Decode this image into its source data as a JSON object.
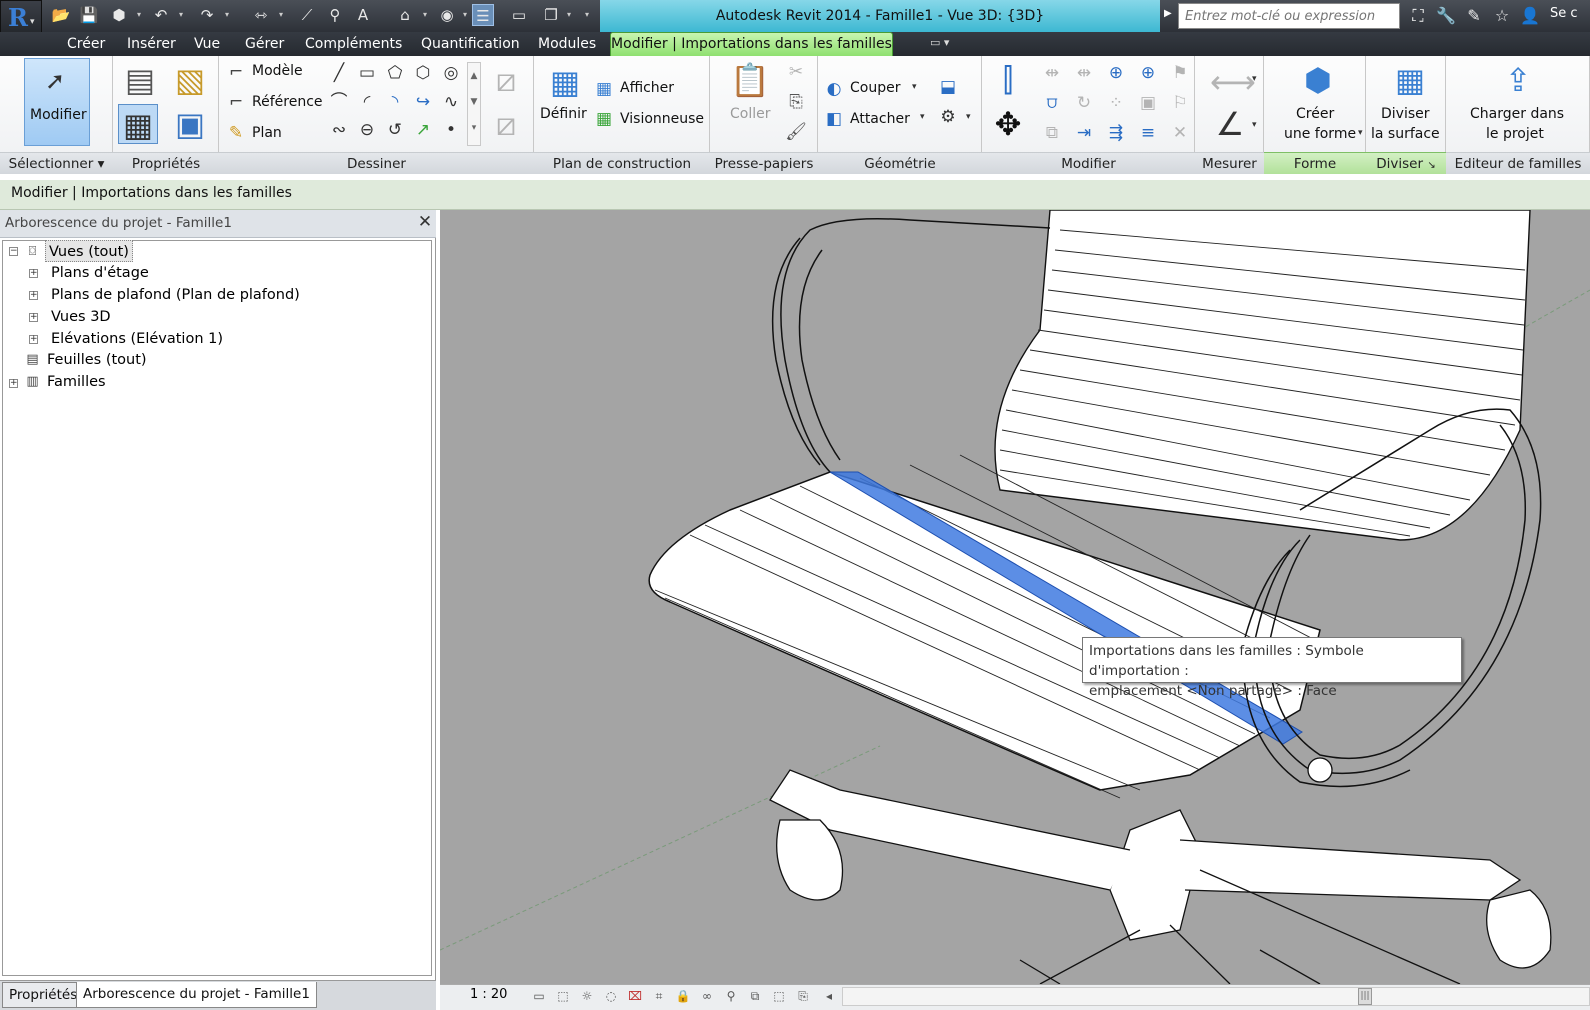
{
  "window": {
    "title": "Autodesk Revit 2014 -     Famille1 - Vue 3D: {3D}",
    "search_placeholder": "Entrez mot-clé ou expression",
    "signin_text": "Se c",
    "title_band_color": "#53c6dc"
  },
  "qat_icons": [
    "open-icon",
    "save-icon",
    "cube-icon",
    "undo-icon",
    "redo-icon",
    "measure-icon",
    "dimension-icon",
    "tag-icon",
    "text-icon",
    "3d-view-icon",
    "section-icon",
    "thin-lines-icon",
    "close-views-icon",
    "switch-windows-icon",
    "customize-icon"
  ],
  "tabs": [
    "Créer",
    "Insérer",
    "Vue",
    "Gérer",
    "Compléments",
    "Quantification",
    "Modules"
  ],
  "active_tab": "Modifier | Importations dans les familles",
  "ribbon": {
    "select": {
      "modify": "Modifier",
      "label": "Sélectionner"
    },
    "properties": {
      "label": "Propriétés"
    },
    "draw": {
      "model": "Modèle",
      "reference": "Référence",
      "plan": "Plan",
      "label": "Dessiner"
    },
    "workplane": {
      "define": "Définir",
      "show": "Afficher",
      "viewer": "Visionneuse",
      "label": "Plan de construction"
    },
    "clipboard": {
      "paste": "Coller",
      "label": "Presse-papiers"
    },
    "geometry": {
      "cut": "Couper",
      "join": "Attacher",
      "label": "Géométrie"
    },
    "modify": {
      "label": "Modifier"
    },
    "measure": {
      "label": "Mesurer"
    },
    "form": {
      "create_line1": "Créer",
      "create_line2": "une forme",
      "label": "Forme"
    },
    "divide": {
      "line1": "Diviser",
      "line2": "la surface",
      "label": "Diviser"
    },
    "family_editor": {
      "line1": "Charger dans",
      "line2": "le projet",
      "label": "Editeur de familles"
    }
  },
  "context_bar": "Modifier | Importations dans les familles",
  "browser": {
    "title": "Arborescence du projet - Famille1",
    "tree": [
      {
        "label": "Vues (tout)",
        "selected": true
      },
      {
        "label": "Plans d'étage"
      },
      {
        "label": "Plans de plafond (Plan de plafond)"
      },
      {
        "label": "Vues 3D"
      },
      {
        "label": "Elévations (Elévation 1)"
      },
      {
        "label": "Feuilles (tout)"
      },
      {
        "label": "Familles"
      }
    ],
    "bottom_tabs": [
      "Propriétés",
      "Arborescence du projet - Famille1"
    ]
  },
  "viewport": {
    "background": "#a4a4a4",
    "highlight_color": "#3f7ae0",
    "tooltip_line1": "Importations dans les familles : Symbole d'importation :",
    "tooltip_line2": "emplacement <Non partagé> : Face"
  },
  "view_control": {
    "scale": "1 : 20"
  }
}
